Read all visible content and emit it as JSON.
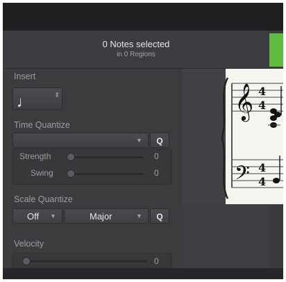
{
  "header": {
    "title": "0 Notes selected",
    "subtitle": "in 0 Regions"
  },
  "insert": {
    "label": "Insert",
    "note_icon": "quarter-note-icon",
    "note_glyph": "♩",
    "stepper_glyph": "⬍"
  },
  "time_quantize": {
    "label": "Time Quantize",
    "value": "",
    "q_label": "Q",
    "strength_label": "Strength",
    "strength_value": "0",
    "swing_label": "Swing",
    "swing_value": "0"
  },
  "scale_quantize": {
    "label": "Scale Quantize",
    "mode_value": "Off",
    "scale_value": "Major",
    "q_label": "Q"
  },
  "velocity": {
    "label": "Velocity",
    "value": "0"
  },
  "icons": {
    "dropdown": "chevron-down-icon",
    "treble": "treble-clef-icon",
    "bass": "bass-clef-icon"
  },
  "colors": {
    "accent_green": "#5fbe3f",
    "panel_bg": "#3b3c3e",
    "paper": "#f5f4ef"
  }
}
